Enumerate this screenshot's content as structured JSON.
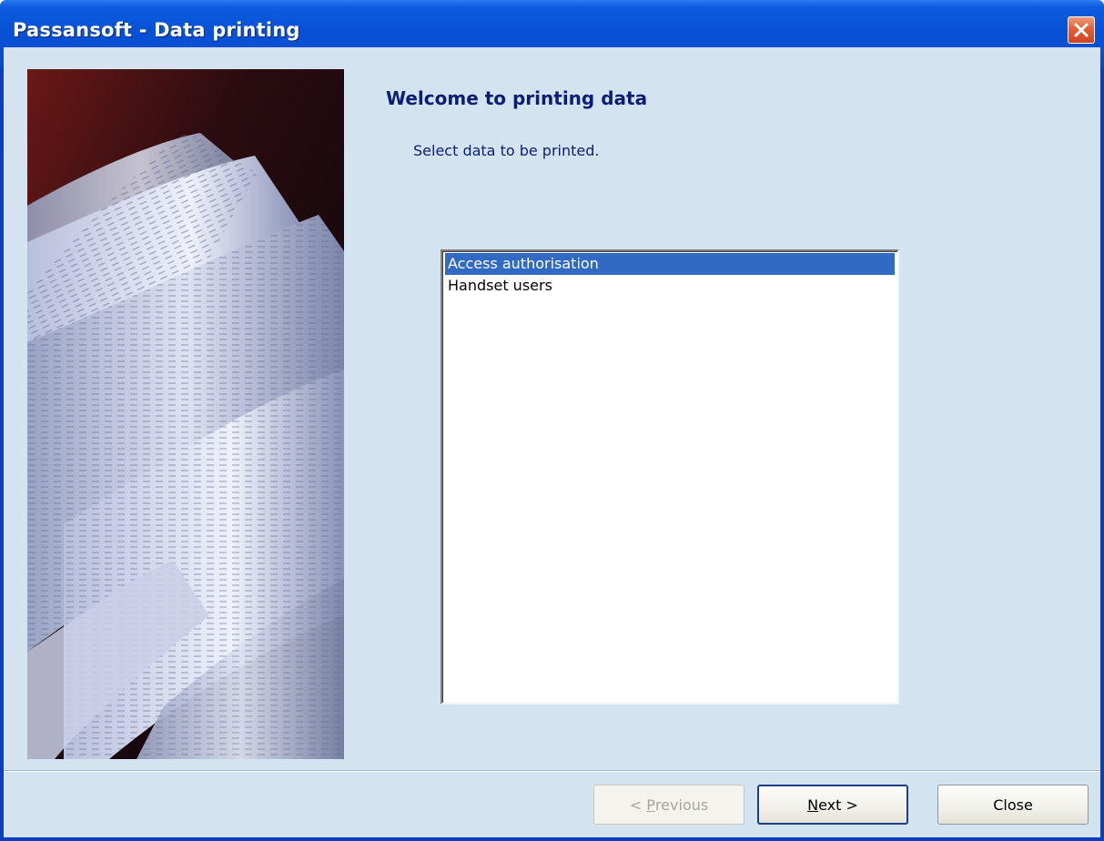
{
  "window": {
    "title": "Passansoft - Data printing",
    "close_icon": "close-icon"
  },
  "wizard": {
    "heading": "Welcome to printing data",
    "instruction": "Select data to be printed.",
    "side_image": "printed-paper-stack-image"
  },
  "data_list": {
    "items": [
      {
        "label": "Access authorisation",
        "selected": true
      },
      {
        "label": "Handset users",
        "selected": false
      }
    ]
  },
  "buttons": {
    "previous": {
      "label_pre": "< ",
      "label_mnemonic": "P",
      "label_post": "revious",
      "enabled": false
    },
    "next": {
      "label_mnemonic": "N",
      "label_post": "ext >",
      "enabled": true
    },
    "close": {
      "label": "Close",
      "enabled": true
    }
  },
  "colors": {
    "titlebar": "#0852d8",
    "selection": "#316ac5",
    "heading_text": "#0a1e78",
    "dialog_bg": "#d4e3f0"
  }
}
